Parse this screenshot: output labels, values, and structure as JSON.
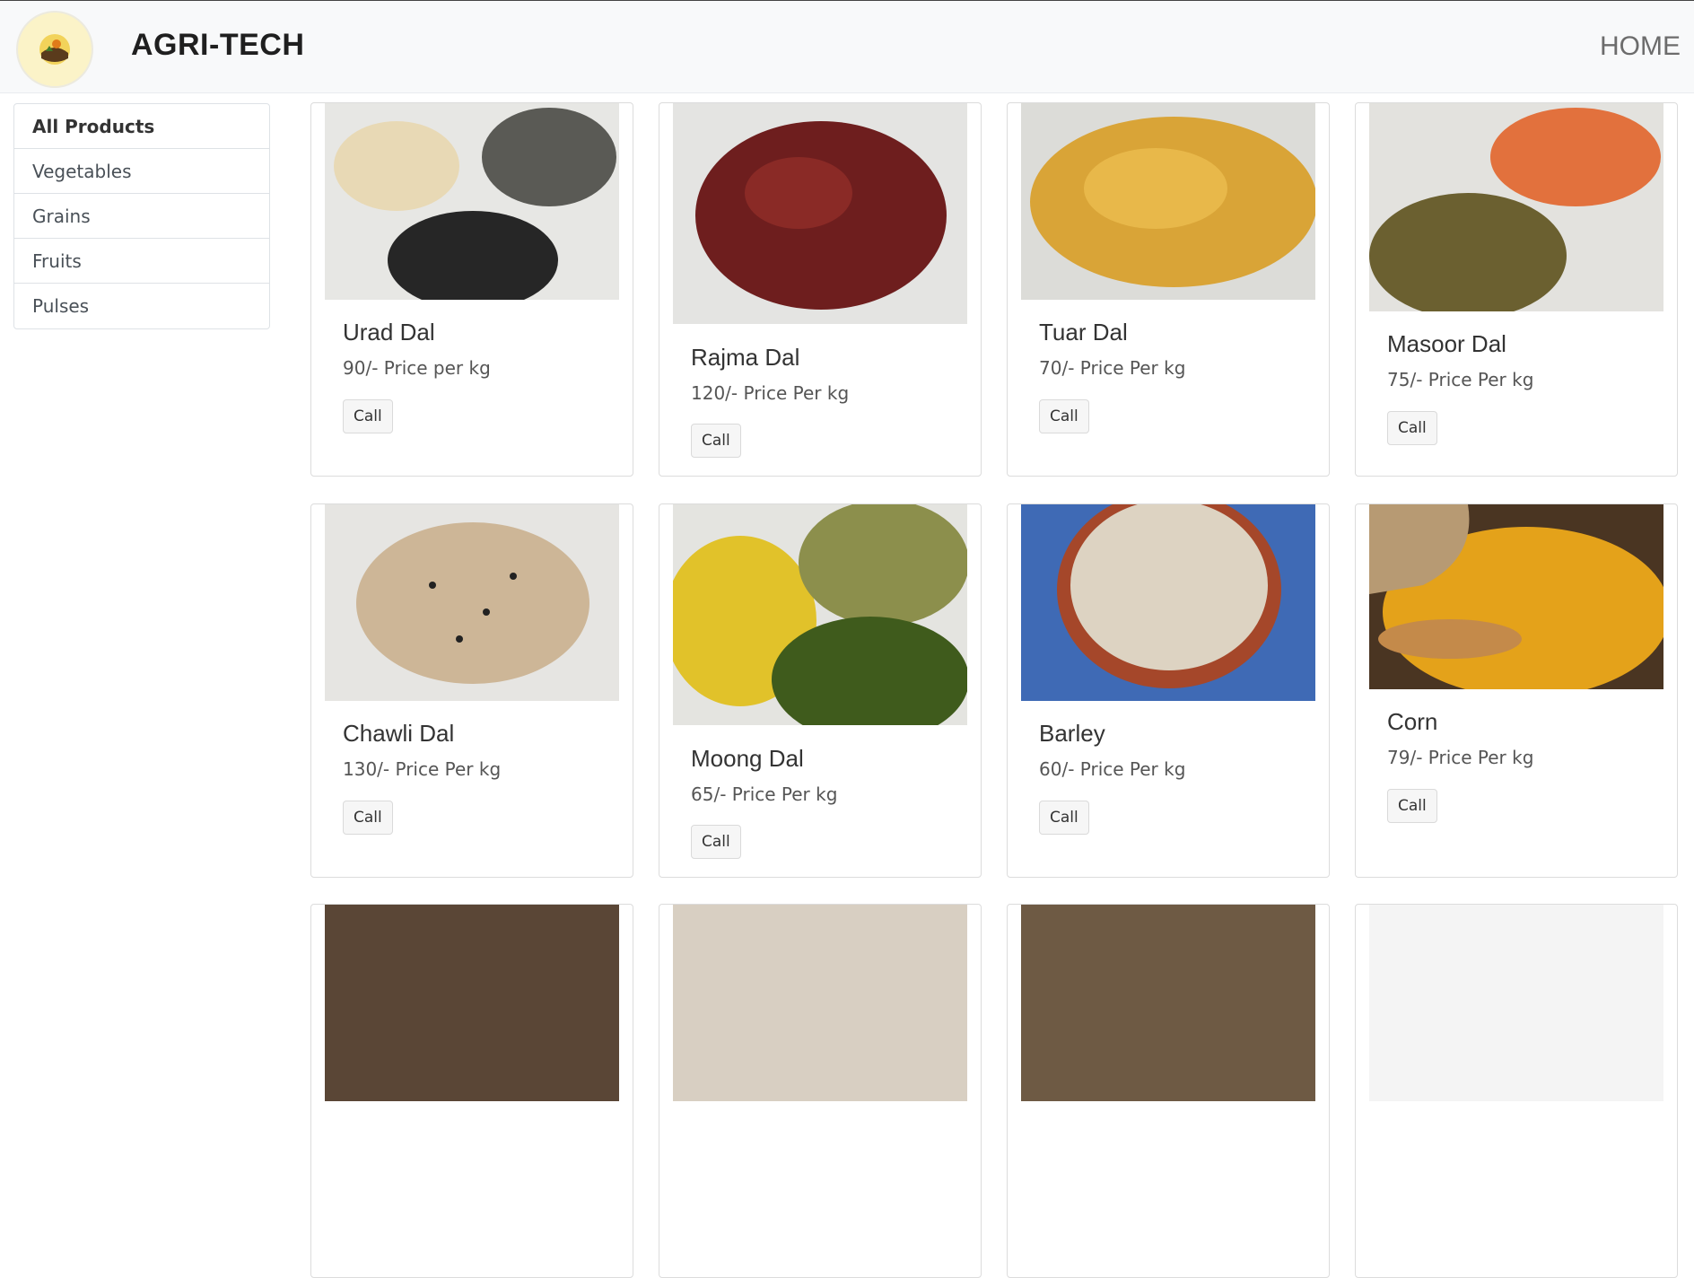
{
  "navbar": {
    "brand": "AGRI-TECH",
    "home_label": "HOME",
    "logo_icon": "farm-logo-icon"
  },
  "sidebar": {
    "items": [
      {
        "label": "All Products",
        "active": true
      },
      {
        "label": "Vegetables",
        "active": false
      },
      {
        "label": "Grains",
        "active": false
      },
      {
        "label": "Fruits",
        "active": false
      },
      {
        "label": "Pulses",
        "active": false
      }
    ]
  },
  "products": [
    {
      "name": "Urad Dal",
      "price": "90/- Price per kg",
      "button": "Call"
    },
    {
      "name": "Rajma Dal",
      "price": "120/- Price Per kg",
      "button": "Call"
    },
    {
      "name": "Tuar Dal",
      "price": "70/- Price Per kg",
      "button": "Call"
    },
    {
      "name": "Masoor Dal",
      "price": "75/- Price Per kg",
      "button": "Call"
    },
    {
      "name": "Chawli Dal",
      "price": "130/- Price Per kg",
      "button": "Call"
    },
    {
      "name": "Moong Dal",
      "price": "65/- Price Per kg",
      "button": "Call"
    },
    {
      "name": "Barley",
      "price": "60/- Price Per kg",
      "button": "Call"
    },
    {
      "name": "Corn",
      "price": "79/- Price Per kg",
      "button": "Call"
    }
  ],
  "colors": {
    "navbar_bg": "#f8f9fa",
    "card_border": "#dcdcdc",
    "button_bg": "#f6f6f6"
  }
}
